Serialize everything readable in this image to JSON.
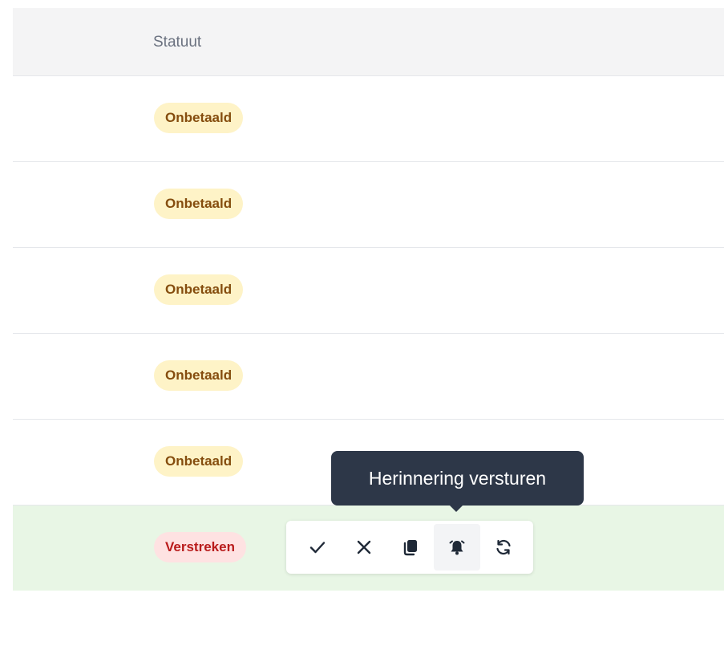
{
  "table": {
    "column_header": "Statuut",
    "rows": [
      {
        "status": "Onbetaald",
        "kind": "unpaid"
      },
      {
        "status": "Onbetaald",
        "kind": "unpaid"
      },
      {
        "status": "Onbetaald",
        "kind": "unpaid"
      },
      {
        "status": "Onbetaald",
        "kind": "unpaid"
      },
      {
        "status": "Onbetaald",
        "kind": "unpaid"
      },
      {
        "status": "Verstreken",
        "kind": "expired"
      }
    ]
  },
  "row_actions": [
    {
      "name": "check-icon",
      "action": "mark-paid"
    },
    {
      "name": "close-icon",
      "action": "cancel"
    },
    {
      "name": "copy-icon",
      "action": "duplicate"
    },
    {
      "name": "bell-icon",
      "action": "send-reminder",
      "active": true
    },
    {
      "name": "refresh-icon",
      "action": "refresh"
    }
  ],
  "tooltip": {
    "text": "Herinnering versturen"
  },
  "colors": {
    "unpaid_bg": "#fef3c7",
    "unpaid_text": "#854d0e",
    "expired_bg": "#fee2e2",
    "expired_text": "#b91c1c",
    "highlight_row_bg": "#e8f6e5",
    "tooltip_bg": "#2d3748"
  }
}
